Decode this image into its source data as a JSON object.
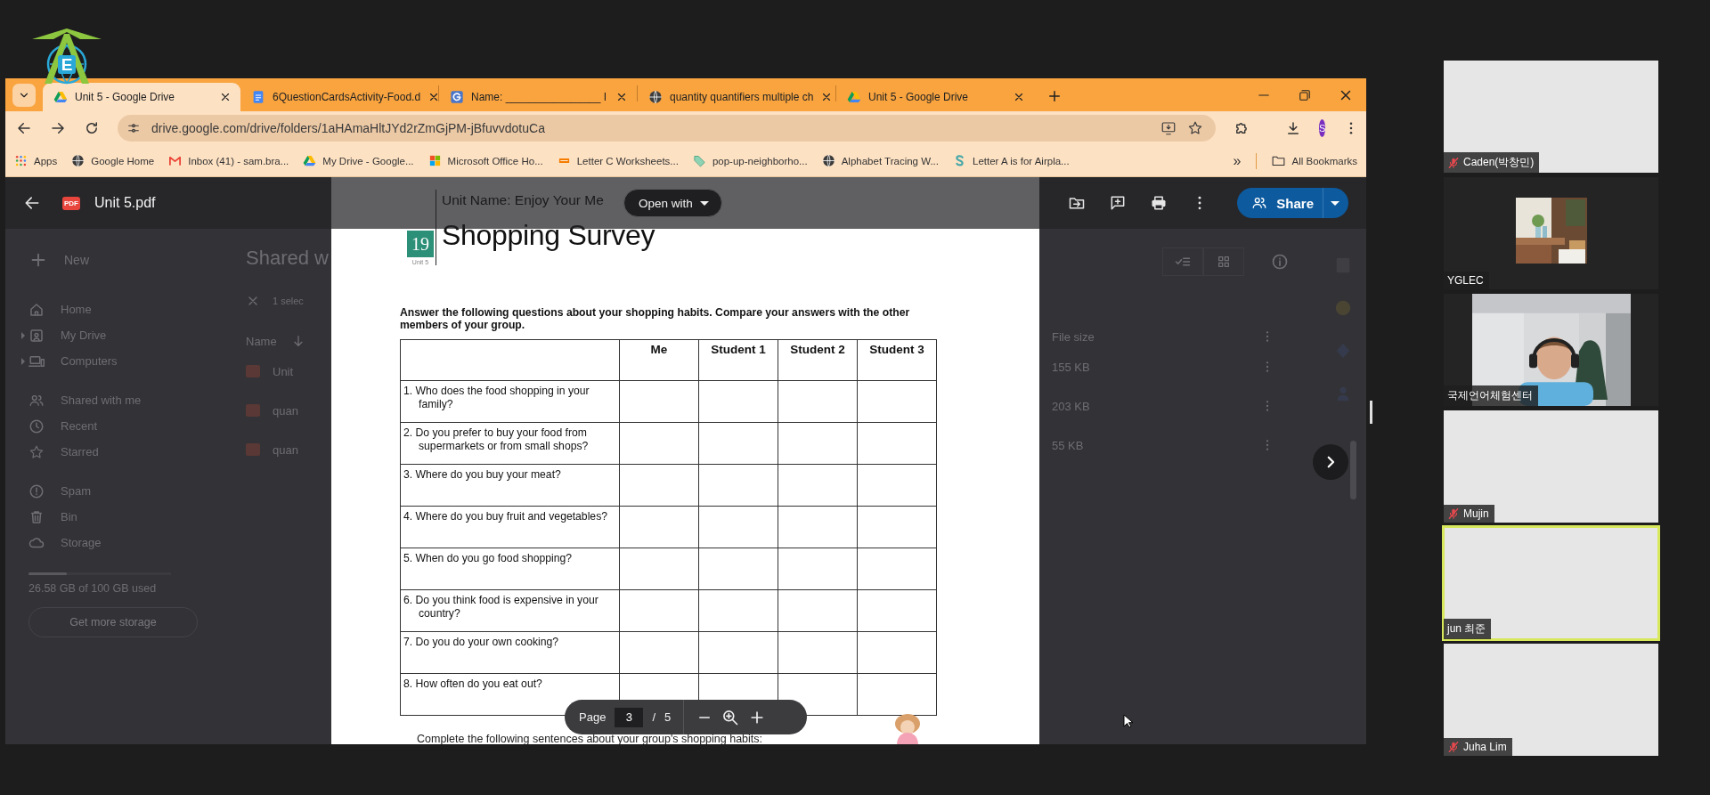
{
  "logo": {
    "letter": "E"
  },
  "browser": {
    "tabs": [
      {
        "title": "Unit 5 - Google Drive",
        "kind": "drive",
        "selected": true
      },
      {
        "title": "6QuestionCardsActivity-Food.d",
        "kind": "docs",
        "selected": false
      },
      {
        "title": "Name: ________________ I",
        "kind": "gsquare",
        "selected": false
      },
      {
        "title": "quantity quantifiers multiple ch",
        "kind": "globe",
        "selected": false
      },
      {
        "title": "Unit 5 - Google Drive",
        "kind": "drive",
        "selected": false
      }
    ],
    "address": "drive.google.com/drive/folders/1aHAmaHltJYd2rZmGjPM-jBfuvvdotuCa",
    "profile_initial": "S",
    "bookmarks": [
      {
        "label": "Apps",
        "kind": "apps"
      },
      {
        "label": "Google Home",
        "kind": "globe"
      },
      {
        "label": "Inbox (41) - sam.bra...",
        "kind": "mail"
      },
      {
        "label": "My Drive - Google...",
        "kind": "drive"
      },
      {
        "label": "Microsoft Office Ho...",
        "kind": "office"
      },
      {
        "label": "Letter C Worksheets...",
        "kind": "bar"
      },
      {
        "label": "pop-up-neighborho...",
        "kind": "tag"
      },
      {
        "label": "Alphabet Tracing W...",
        "kind": "globe"
      },
      {
        "label": "Letter A is for Airpla...",
        "kind": "curve"
      }
    ],
    "more_bookmarks": "»",
    "all_bookmarks": "All Bookmarks"
  },
  "drive": {
    "new": "New",
    "nav_groups": [
      [
        {
          "label": "Home",
          "kind": "home",
          "expandable": false
        },
        {
          "label": "My Drive",
          "kind": "drivebox",
          "expandable": true
        },
        {
          "label": "Computers",
          "kind": "computer",
          "expandable": true
        }
      ],
      [
        {
          "label": "Shared with me",
          "kind": "people",
          "expandable": false
        },
        {
          "label": "Recent",
          "kind": "clock",
          "expandable": false
        },
        {
          "label": "Starred",
          "kind": "star",
          "expandable": false
        }
      ],
      [
        {
          "label": "Spam",
          "kind": "spam",
          "expandable": false
        },
        {
          "label": "Bin",
          "kind": "bin",
          "expandable": false
        },
        {
          "label": "Storage",
          "kind": "cloud",
          "expandable": false
        }
      ]
    ],
    "storage": {
      "text": "26.58 GB of 100 GB used",
      "level": 0.27
    },
    "get_storage": "Get more storage",
    "heading": "Shared w",
    "selection": "1 selec",
    "name_header": "Name",
    "size_header": "File size",
    "files": [
      {
        "name": "Unit",
        "size": "155 KB"
      },
      {
        "name": "quan",
        "size": "203 KB"
      },
      {
        "name": "quan",
        "size": "55 KB"
      }
    ]
  },
  "viewer": {
    "file_badge": "PDF",
    "file_name": "Unit 5.pdf",
    "open_with": "Open with",
    "share": "Share",
    "page": {
      "label": "Page",
      "current": "3",
      "separator": "/",
      "total": "5"
    }
  },
  "document": {
    "unit_name": "Unit Name: Enjoy Your Me",
    "badge_number": "19",
    "badge_caption": "Unit 5",
    "title": "Shopping Survey",
    "instructions": "Answer the following questions about your shopping habits. Compare your answers with the other members of your group.",
    "columns": [
      "Me",
      "Student 1",
      "Student 2",
      "Student 3"
    ],
    "questions": [
      "1. Who does the food shopping in your family?",
      "2. Do you prefer to buy your food from supermarkets or from small shops?",
      "3. Where do you buy your meat?",
      "4. Where do you buy fruit and vegetables?",
      "5. When do you go food shopping?",
      "6. Do you think food is expensive in your country?",
      "7. Do you do your own cooking?",
      "8. How often do you eat out?"
    ],
    "footer": "Complete the following sentences about your group's shopping habits:"
  },
  "participants": [
    {
      "name": "Caden(박창민)",
      "muted": true,
      "kind": "blank",
      "speaking": false
    },
    {
      "name": "YGLEC",
      "muted": false,
      "kind": "thumbnail",
      "speaking": false
    },
    {
      "name": "국제언어체험센터",
      "muted": false,
      "kind": "camera",
      "speaking": false
    },
    {
      "name": "Mujin",
      "muted": true,
      "kind": "blank",
      "speaking": false
    },
    {
      "name": "jun 최준",
      "muted": false,
      "kind": "blank",
      "speaking": true
    },
    {
      "name": "Juha Lim",
      "muted": true,
      "kind": "blank",
      "speaking": false
    }
  ]
}
